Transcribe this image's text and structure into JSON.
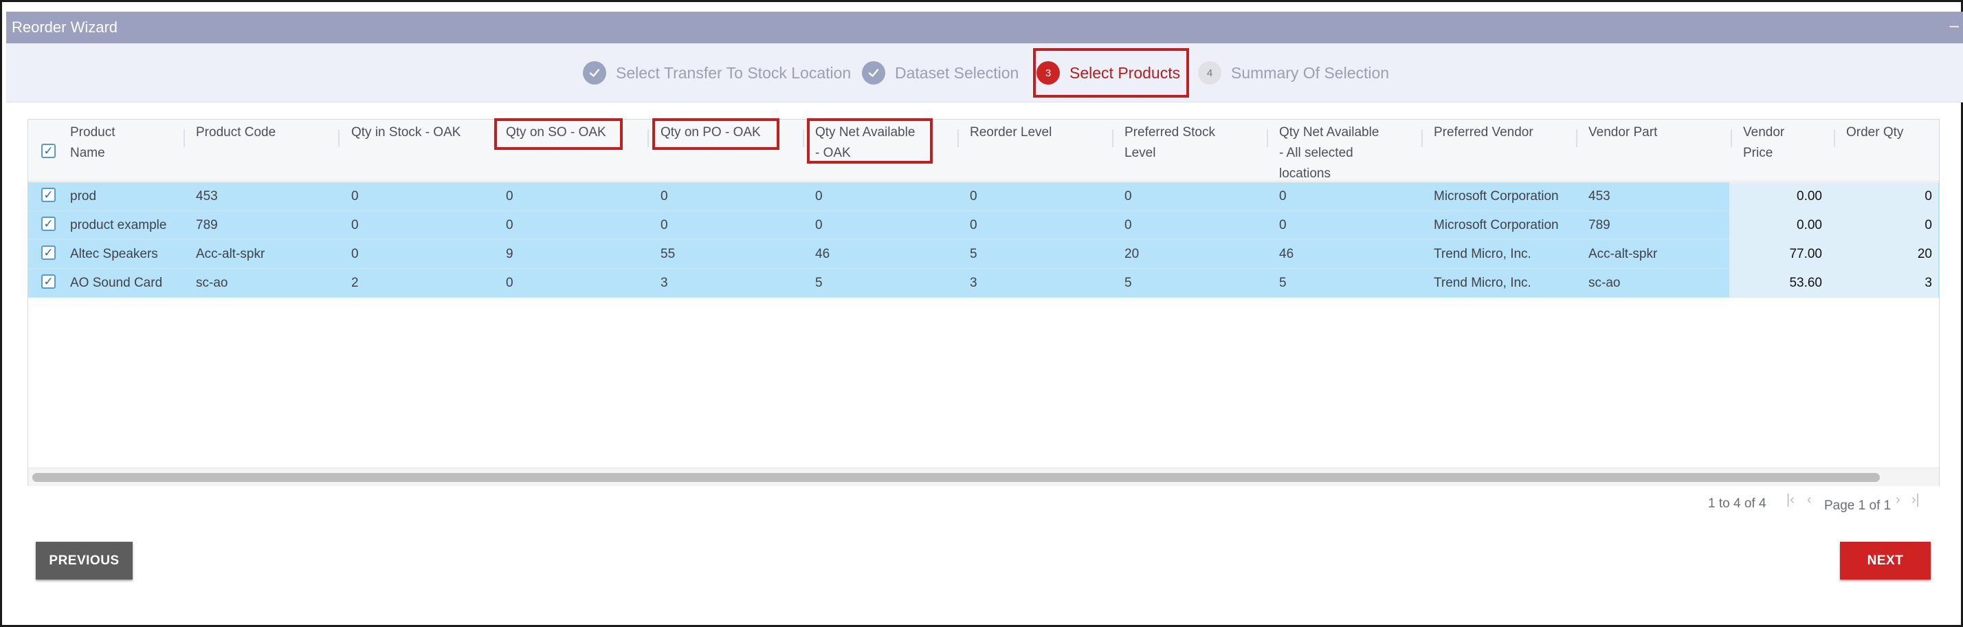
{
  "window": {
    "title": "Reorder Wizard",
    "minimize_glyph": "–"
  },
  "steps": [
    {
      "number": "1",
      "label": "Select Transfer To Stock Location",
      "state": "done"
    },
    {
      "number": "2",
      "label": "Dataset Selection",
      "state": "done"
    },
    {
      "number": "3",
      "label": "Select Products",
      "state": "current"
    },
    {
      "number": "4",
      "label": "Summary Of Selection",
      "state": "todo"
    }
  ],
  "table": {
    "columns": [
      {
        "line1": "Product",
        "line2": "Name",
        "line3": ""
      },
      {
        "line1": "Product Code",
        "line2": "",
        "line3": ""
      },
      {
        "line1": "Qty in Stock - OAK",
        "line2": "",
        "line3": ""
      },
      {
        "line1": "Qty on SO - OAK",
        "line2": "",
        "line3": ""
      },
      {
        "line1": "Qty on PO - OAK",
        "line2": "",
        "line3": ""
      },
      {
        "line1": "Qty Net Available",
        "line2": "- OAK",
        "line3": ""
      },
      {
        "line1": "Reorder Level",
        "line2": "",
        "line3": ""
      },
      {
        "line1": "Preferred Stock",
        "line2": "Level",
        "line3": ""
      },
      {
        "line1": "Qty Net Available",
        "line2": "- All selected",
        "line3": "locations"
      },
      {
        "line1": "Preferred Vendor",
        "line2": "",
        "line3": ""
      },
      {
        "line1": "Vendor Part",
        "line2": "",
        "line3": ""
      },
      {
        "line1": "Vendor",
        "line2": "Price",
        "line3": ""
      },
      {
        "line1": "Order Qty",
        "line2": "",
        "line3": ""
      }
    ],
    "rows": [
      [
        "prod",
        "453",
        "0",
        "0",
        "0",
        "0",
        "0",
        "0",
        "0",
        "Microsoft Corporation",
        "453",
        "0.00",
        "0"
      ],
      [
        "product example",
        "789",
        "0",
        "0",
        "0",
        "0",
        "0",
        "0",
        "0",
        "Microsoft Corporation",
        "789",
        "0.00",
        "0"
      ],
      [
        "Altec Speakers",
        "Acc-alt-spkr",
        "0",
        "9",
        "55",
        "46",
        "5",
        "20",
        "46",
        "Trend Micro, Inc.",
        "Acc-alt-spkr",
        "77.00",
        "20"
      ],
      [
        "AO Sound Card",
        "sc-ao",
        "2",
        "0",
        "3",
        "5",
        "3",
        "5",
        "5",
        "Trend Micro, Inc.",
        "sc-ao",
        "53.60",
        "3"
      ]
    ],
    "checkmark_glyph": "✓"
  },
  "pagination": {
    "range": "1 to 4 of 4",
    "page": "Page 1 of 1",
    "first_glyph": "|‹",
    "prev_glyph": "‹",
    "next_glyph": "›",
    "last_glyph": "›|"
  },
  "buttons": {
    "previous": "PREVIOUS",
    "next": "NEXT"
  },
  "colors": {
    "accent_red": "#cc2424",
    "row_selected": "#b6e3fa",
    "titlebar": "#9aa0bd"
  }
}
